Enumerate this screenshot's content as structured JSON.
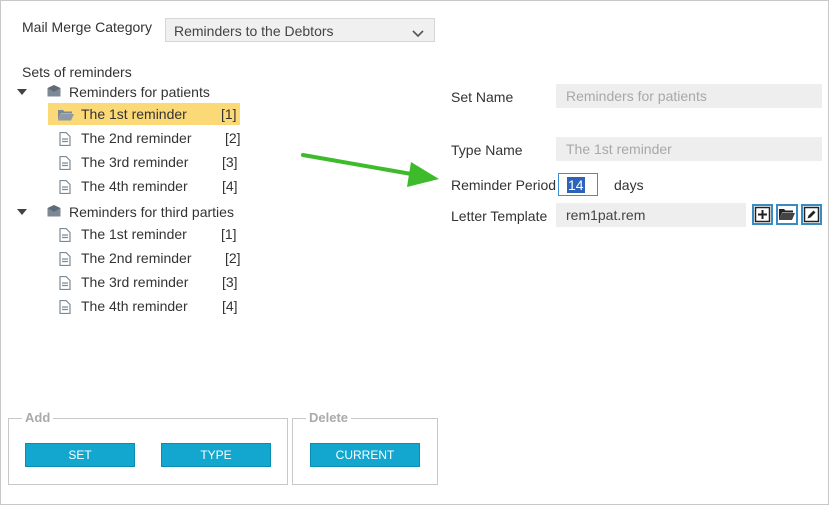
{
  "category": {
    "label": "Mail Merge Category",
    "value": "Reminders to the Debtors"
  },
  "tree": {
    "title": "Sets of reminders",
    "groups": [
      {
        "label": "Reminders for patients",
        "items": [
          {
            "label": "The 1st reminder",
            "index": "[1]"
          },
          {
            "label": "The 2nd reminder",
            "index": "[2]"
          },
          {
            "label": "The 3rd reminder",
            "index": "[3]"
          },
          {
            "label": "The 4th reminder",
            "index": "[4]"
          }
        ]
      },
      {
        "label": "Reminders for third parties",
        "items": [
          {
            "label": "The 1st reminder",
            "index": "[1]"
          },
          {
            "label": "The 2nd reminder",
            "index": "[2]"
          },
          {
            "label": "The 3rd reminder",
            "index": "[3]"
          },
          {
            "label": "The 4th reminder",
            "index": "[4]"
          }
        ]
      }
    ]
  },
  "form": {
    "set_name_label": "Set Name",
    "set_name_value": "Reminders for patients",
    "type_name_label": "Type Name",
    "type_name_value": "The 1st reminder",
    "period_label": "Reminder Period",
    "period_value": "14",
    "period_unit": "days",
    "template_label": "Letter Template",
    "template_value": "rem1pat.rem"
  },
  "add_group": {
    "legend": "Add",
    "set_button": "SET",
    "type_button": "TYPE"
  },
  "delete_group": {
    "legend": "Delete",
    "current_button": "CURRENT"
  },
  "colors": {
    "accent": "#13a7cf",
    "selection": "#fbd977",
    "arrow": "#3dbb2b"
  },
  "icons": [
    "chevron-down-icon",
    "caret-down-icon",
    "envelope-icon",
    "folder-open-icon",
    "document-icon",
    "add-icon",
    "open-folder-icon",
    "edit-icon",
    "arrow-icon"
  ]
}
